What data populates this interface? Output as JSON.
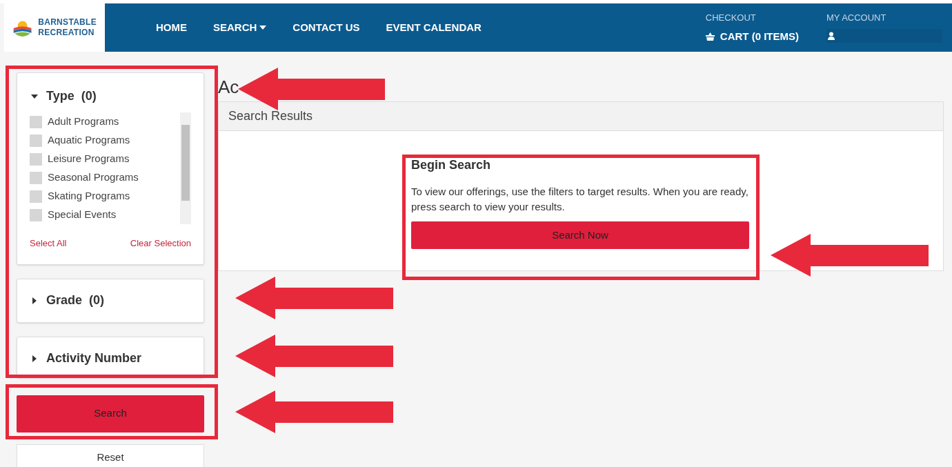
{
  "header": {
    "logo_lines": [
      "BARNSTABLE",
      "RECREATION"
    ],
    "nav": [
      {
        "label": "HOME",
        "dropdown": false
      },
      {
        "label": "SEARCH",
        "dropdown": true
      },
      {
        "label": "CONTACT US",
        "dropdown": false
      },
      {
        "label": "EVENT CALENDAR",
        "dropdown": false
      }
    ],
    "checkout": {
      "label": "CHECKOUT",
      "cart": "CART (0 ITEMS)"
    },
    "account": {
      "label": "MY ACCOUNT"
    }
  },
  "filters": [
    {
      "title": "Type",
      "count": "(0)",
      "expanded": true,
      "options": [
        {
          "label": "Adult Programs",
          "checked": false
        },
        {
          "label": "Aquatic Programs",
          "checked": false
        },
        {
          "label": "Leisure Programs",
          "checked": false
        },
        {
          "label": "Seasonal Programs",
          "checked": false
        },
        {
          "label": "Skating Programs",
          "checked": false
        },
        {
          "label": "Special Events",
          "checked": false
        }
      ],
      "select_all": "Select All",
      "clear": "Clear Selection"
    },
    {
      "title": "Grade",
      "count": "(0)",
      "expanded": false
    },
    {
      "title": "Activity Number",
      "expanded": false
    }
  ],
  "search_button": "Search",
  "reset_button": "Reset",
  "heading": "Ac",
  "results": {
    "title": "Search Results",
    "card_title": "Begin Search",
    "card_text": "To view our offerings, use the filters to target results. When you are ready, press search to view your results.",
    "button": "Search Now"
  }
}
